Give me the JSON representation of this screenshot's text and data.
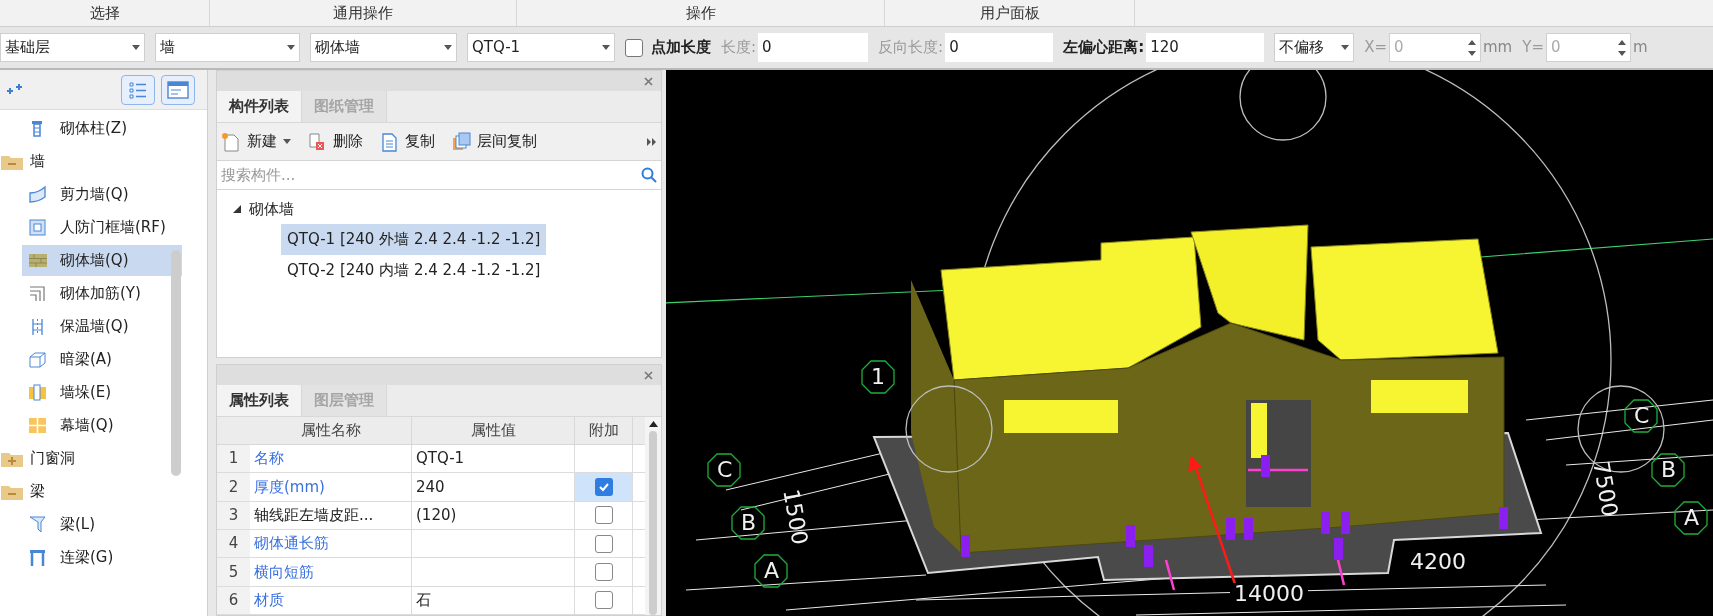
{
  "ribbon_sections": [
    "选择",
    "通用操作",
    "操作",
    "用户面板"
  ],
  "toolbar": {
    "floor": "基础层",
    "category": "墙",
    "type": "砌体墙",
    "component": "QTQ-1",
    "add_length": {
      "label": "点加长度",
      "checked": false
    },
    "length": {
      "label": "长度:",
      "value": "0",
      "disabled": true
    },
    "reverse_length": {
      "label": "反向长度:",
      "value": "0",
      "disabled": true
    },
    "offset": {
      "label": "左偏心距离:",
      "value": "120",
      "disabled": false
    },
    "offset_mode": "不偏移",
    "x": {
      "label": "X=",
      "value": "0",
      "unit": "mm",
      "disabled": true
    },
    "y": {
      "label": "Y=",
      "value": "0",
      "unit": "m",
      "disabled": true
    }
  },
  "component_tree": [
    {
      "kind": "item",
      "label": "砌体柱(Z)",
      "selected": false
    },
    {
      "kind": "folder",
      "label": "墙",
      "expanded": true,
      "children": [
        {
          "kind": "item",
          "label": "剪力墙(Q)",
          "selected": false
        },
        {
          "kind": "item",
          "label": "人防门框墙(RF)",
          "selected": false
        },
        {
          "kind": "item",
          "label": "砌体墙(Q)",
          "selected": true
        },
        {
          "kind": "item",
          "label": "砌体加筋(Y)",
          "selected": false
        },
        {
          "kind": "item",
          "label": "保温墙(Q)",
          "selected": false
        },
        {
          "kind": "item",
          "label": "暗梁(A)",
          "selected": false
        },
        {
          "kind": "item",
          "label": "墙垛(E)",
          "selected": false
        },
        {
          "kind": "item",
          "label": "幕墙(Q)",
          "selected": false
        }
      ]
    },
    {
      "kind": "folder",
      "label": "门窗洞",
      "expanded": false
    },
    {
      "kind": "folder",
      "label": "梁",
      "expanded": true,
      "children": [
        {
          "kind": "item",
          "label": "梁(L)",
          "selected": false
        },
        {
          "kind": "item",
          "label": "连梁(G)",
          "selected": false
        }
      ]
    }
  ],
  "component_panel": {
    "tabs": [
      {
        "label": "构件列表",
        "selected": true
      },
      {
        "label": "图纸管理",
        "selected": false
      }
    ],
    "actions": [
      {
        "label": "新建",
        "dropdown": true
      },
      {
        "label": "删除",
        "dropdown": false
      },
      {
        "label": "复制",
        "dropdown": false
      },
      {
        "label": "层间复制",
        "dropdown": false
      }
    ],
    "search": {
      "placeholder": "搜索构件..."
    },
    "tree": [
      {
        "label": "砌体墙",
        "expanded": true,
        "children": [
          {
            "label": "QTQ-1 [240 外墙 2.4 2.4 -1.2 -1.2]",
            "selected": true
          },
          {
            "label": "QTQ-2 [240 内墙 2.4 2.4 -1.2 -1.2]",
            "selected": false
          }
        ]
      }
    ]
  },
  "property_panel": {
    "tabs": [
      {
        "label": "属性列表",
        "selected": true
      },
      {
        "label": "图层管理",
        "selected": false
      }
    ],
    "columns": [
      "属性名称",
      "属性值",
      "附加"
    ],
    "rows": [
      {
        "index": "1",
        "name": "名称",
        "value": "QTQ-1",
        "public": true,
        "kind": "text",
        "selected": false
      },
      {
        "index": "2",
        "name": "厚度(mm)",
        "value": "240",
        "public": true,
        "kind": "checkbox",
        "checked": true,
        "selected": true
      },
      {
        "index": "3",
        "name": "轴线距左墙皮距...",
        "value": "(120)",
        "public": false,
        "kind": "checkbox",
        "checked": false,
        "selected": false
      },
      {
        "index": "4",
        "name": "砌体通长筋",
        "public": true,
        "kind": "checkbox",
        "checked": false,
        "selected": false
      },
      {
        "index": "5",
        "name": "横向短筋",
        "public": true,
        "kind": "checkbox",
        "checked": false,
        "selected": false
      },
      {
        "index": "6",
        "name": "材质",
        "value": "石",
        "public": true,
        "kind": "checkbox",
        "checked": false,
        "selected": false
      }
    ]
  },
  "viewport": {
    "labels": [
      "1",
      "C",
      "B",
      "A",
      "C",
      "B",
      "A",
      "1500",
      "7500",
      "4200",
      "14000"
    ]
  }
}
